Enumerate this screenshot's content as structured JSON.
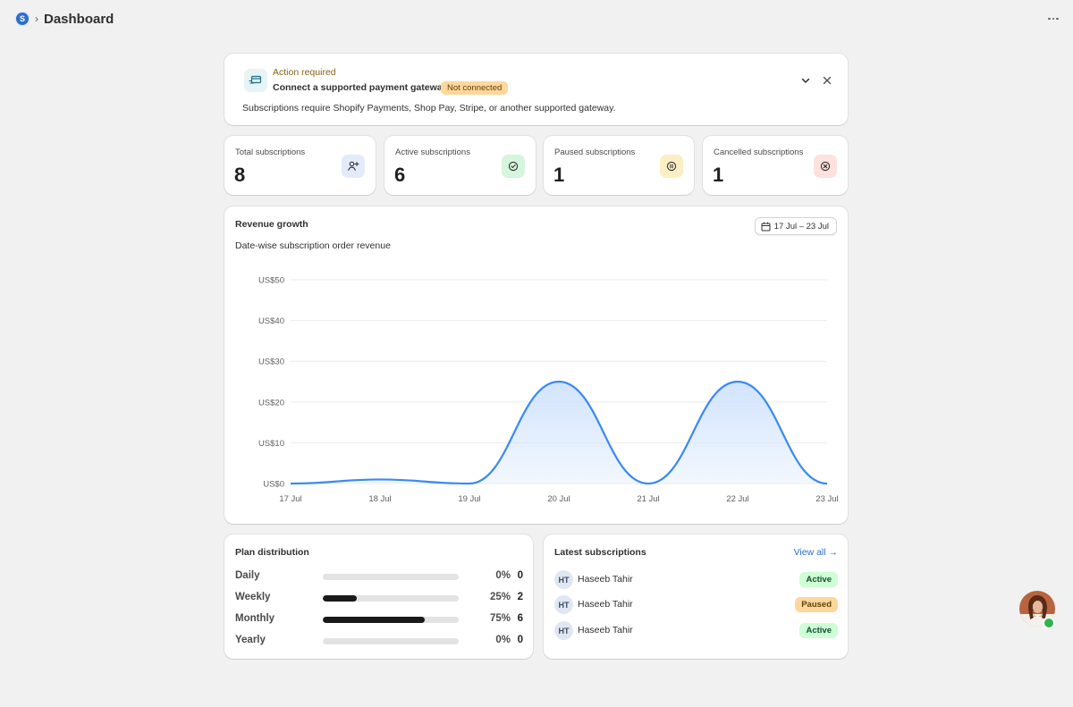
{
  "header": {
    "app_logo_letter": "S",
    "separator": "›",
    "title": "Dashboard"
  },
  "banner": {
    "kicker": "Action required",
    "title": "Connect a supported payment gateway",
    "badge": "Not connected",
    "body": "Subscriptions require Shopify Payments, Shop Pay, Stripe, or another supported gateway.",
    "icon": "payment-card-icon"
  },
  "stats": [
    {
      "label": "Total subscriptions",
      "value": "8",
      "icon": "add-user-icon",
      "icon_bg": "#e3ebfb",
      "icon_color": "#303030"
    },
    {
      "label": "Active subscriptions",
      "value": "6",
      "icon": "check-circle-icon",
      "icon_bg": "#d6f5dd",
      "icon_color": "#303030"
    },
    {
      "label": "Paused subscriptions",
      "value": "1",
      "icon": "pause-circle-icon",
      "icon_bg": "#fcefc4",
      "icon_color": "#303030"
    },
    {
      "label": "Cancelled subscriptions",
      "value": "1",
      "icon": "x-circle-icon",
      "icon_bg": "#fde1df",
      "icon_color": "#303030"
    }
  ],
  "revenue": {
    "title": "Revenue growth",
    "subtitle": "Date-wise subscription order revenue",
    "date_range": "17 Jul – 23 Jul"
  },
  "chart_data": {
    "type": "area",
    "title": "Revenue growth",
    "subtitle": "Date-wise subscription order revenue",
    "categories": [
      "17 Jul",
      "18 Jul",
      "19 Jul",
      "20 Jul",
      "21 Jul",
      "22 Jul",
      "23 Jul"
    ],
    "values": [
      0,
      1,
      0,
      25,
      0,
      25,
      0
    ],
    "y_ticks": [
      "US$0",
      "US$10",
      "US$20",
      "US$30",
      "US$40",
      "US$50"
    ],
    "ylim": [
      0,
      50
    ],
    "grid": true,
    "line_color": "#3b8af2",
    "fill_color": "#cfe2fd"
  },
  "plans": {
    "title": "Plan distribution",
    "items": [
      {
        "name": "Daily",
        "pct_label": "0%",
        "fraction": 0,
        "count": "0"
      },
      {
        "name": "Weekly",
        "pct_label": "25%",
        "fraction": 0.25,
        "count": "2"
      },
      {
        "name": "Monthly",
        "pct_label": "75%",
        "fraction": 0.75,
        "count": "6"
      },
      {
        "name": "Yearly",
        "pct_label": "0%",
        "fraction": 0,
        "count": "0"
      }
    ]
  },
  "latest": {
    "title": "Latest subscriptions",
    "view_all": "View all →",
    "rows": [
      {
        "initials": "HT",
        "name": "Haseeb Tahir",
        "status": "Active",
        "status_bg": "#cdfed4",
        "status_color": "#0c5132"
      },
      {
        "initials": "HT",
        "name": "Haseeb Tahir",
        "status": "Paused",
        "status_bg": "#ffd79d",
        "status_color": "#5e4200"
      },
      {
        "initials": "HT",
        "name": "Haseeb Tahir",
        "status": "Active",
        "status_bg": "#cdfed4",
        "status_color": "#0c5132"
      }
    ]
  },
  "profile": {
    "status": "online"
  }
}
